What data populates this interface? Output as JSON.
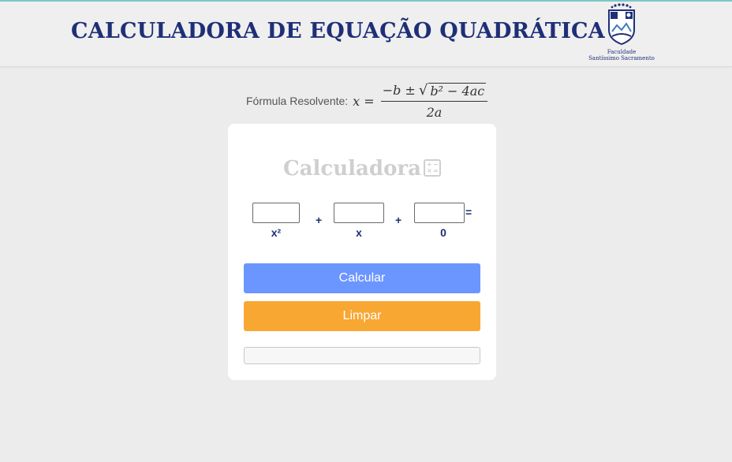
{
  "header": {
    "title": "CALCULADORA DE EQUAÇÃO QUADRÁTICA",
    "logo_caption_line1": "Faculdade",
    "logo_caption_line2": "Santíssimo Sacramento"
  },
  "formula": {
    "label": "Fórmula Resolvente:",
    "lhs": "x =",
    "numerator_prefix": "−b ±",
    "radicand": "b² − 4ac",
    "denominator": "2a"
  },
  "calculator": {
    "title": "Calculadora",
    "inputs": {
      "a": {
        "value": "",
        "label": "x²"
      },
      "b": {
        "value": "",
        "label": "x"
      },
      "c": {
        "value": "",
        "label": "0"
      }
    },
    "plus1": "+",
    "plus2": "+",
    "equals": "=",
    "calc_button": "Calcular",
    "clear_button": "Limpar",
    "result": ""
  },
  "colors": {
    "title": "#1f2f77",
    "calc_button": "#6b96ff",
    "clear_button": "#f8a732",
    "top_line": "#7fc6c9"
  },
  "icons": {
    "calculator_icon": "calculator-icon",
    "logo": "faculdade-logo-icon"
  }
}
